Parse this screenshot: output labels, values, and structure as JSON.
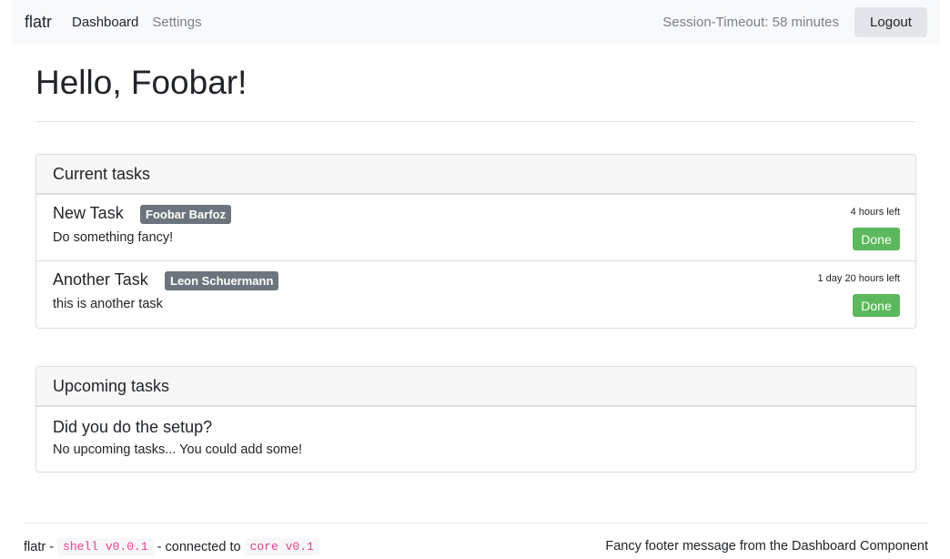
{
  "navbar": {
    "brand": "flatr",
    "links": [
      {
        "label": "Dashboard",
        "active": true
      },
      {
        "label": "Settings",
        "active": false
      }
    ],
    "session_timeout": "Session-Timeout: 58 minutes",
    "logout_label": "Logout"
  },
  "page": {
    "title": "Hello, Foobar!"
  },
  "current_tasks": {
    "header": "Current tasks",
    "tasks": [
      {
        "title": "New Task",
        "assignee": "Foobar Barfoz",
        "description": "Do something fancy!",
        "time_left": "4 hours left",
        "done_label": "Done"
      },
      {
        "title": "Another Task",
        "assignee": "Leon Schuermann",
        "description": "this is another task",
        "time_left": "1 day 20 hours left",
        "done_label": "Done"
      }
    ]
  },
  "upcoming_tasks": {
    "header": "Upcoming tasks",
    "title": "Did you do the setup?",
    "text": "No upcoming tasks... You could add some!"
  },
  "footer": {
    "prefix": "flatr -",
    "shell_version": "shell v0.0.1",
    "connected_text": "- connected to",
    "core_version": "core v0.1",
    "message": "Fancy footer message from the Dashboard Component"
  },
  "colors": {
    "navbar_bg": "#f8f9fa",
    "badge_bg": "#6c757d",
    "done_button": "#5cb85c",
    "code_text": "#e83e8c"
  }
}
